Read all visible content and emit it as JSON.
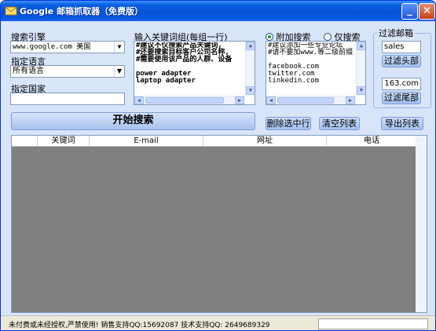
{
  "window": {
    "title": "Google 邮箱抓取器（免费版）",
    "minimize_glyph": "_",
    "close_glyph": "×"
  },
  "search_engine": {
    "label": "搜索引擎",
    "value": "www.google.com 美国"
  },
  "language": {
    "label": "指定语言",
    "value": "所有语言"
  },
  "country": {
    "label": "指定国家",
    "value": ""
  },
  "keywords": {
    "label": "输入关键词组(每组一行)",
    "text": "#建议不仅搜索产品关键词,\n#还要搜索目标客户公司名称,\n#需要使用该产品的人群、设备\n\npower adapter\nlaptop adapter"
  },
  "search_mode": {
    "option_append": "附加搜索",
    "option_only": "仅搜索",
    "selected": "append",
    "text": "#建议添加一些专业论坛\n#请不要加www.等二级前缀\n\nfacebook.com\ntwitter.com\nlinkedin.com"
  },
  "filter": {
    "group_label": "过滤邮箱",
    "head_value": "sales",
    "head_button": "过滤头部",
    "tail_value": "163.com",
    "tail_button": "过滤尾部"
  },
  "actions": {
    "start": "开始搜索",
    "delete_selected": "删除选中行",
    "clear_list": "清空列表",
    "export_list": "导出列表"
  },
  "results": {
    "columns": [
      "",
      "关键词",
      "E-mail",
      "网址",
      "电话"
    ],
    "rows": []
  },
  "status": {
    "text": "未付费或未经授权,严禁使用! 销售支持QQ:15692087  技术支持QQ: 2649689329"
  },
  "colors": {
    "title_bar": "#0653d7",
    "window_bg": "#d8e4f8",
    "list_bg": "#808080",
    "radio_dot": "#21a121"
  },
  "icons": {
    "app": "envelope-icon",
    "dropdown": "chevron-down-icon",
    "scroll_up": "arrow-up-icon",
    "scroll_down": "arrow-down-icon",
    "scroll_left": "arrow-left-icon",
    "scroll_right": "arrow-right-icon"
  }
}
